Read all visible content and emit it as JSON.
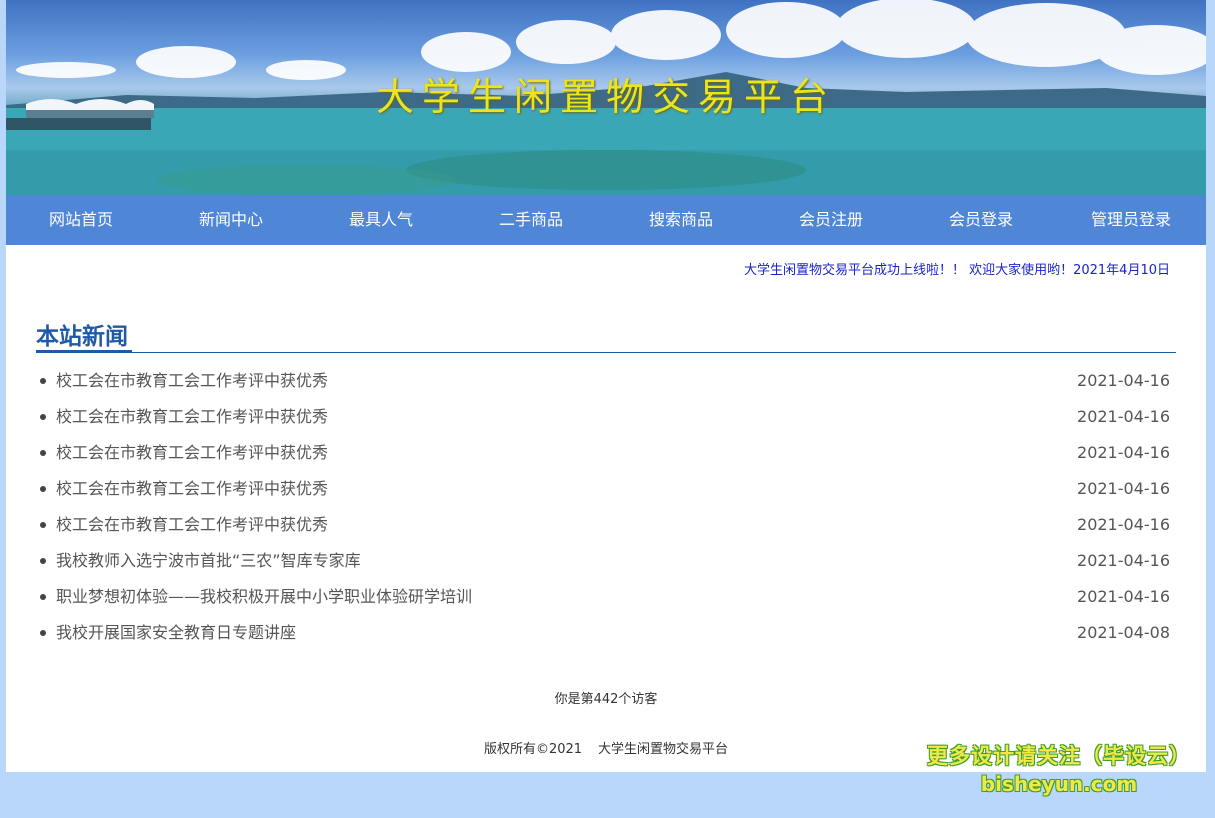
{
  "banner": {
    "title": "大学生闲置物交易平台"
  },
  "nav": {
    "items": [
      "网站首页",
      "新闻中心",
      "最具人气",
      "二手商品",
      "搜索商品",
      "会员注册",
      "会员登录",
      "管理员登录"
    ]
  },
  "marquee": {
    "text": "大学生闲置物交易平台成功上线啦！！ 欢迎大家使用哟！2021年4月10日"
  },
  "news": {
    "title": "本站新闻",
    "items": [
      {
        "title": "校工会在市教育工会工作考评中获优秀",
        "date": "2021-04-16"
      },
      {
        "title": "校工会在市教育工会工作考评中获优秀",
        "date": "2021-04-16"
      },
      {
        "title": "校工会在市教育工会工作考评中获优秀",
        "date": "2021-04-16"
      },
      {
        "title": "校工会在市教育工会工作考评中获优秀",
        "date": "2021-04-16"
      },
      {
        "title": "校工会在市教育工会工作考评中获优秀",
        "date": "2021-04-16"
      },
      {
        "title": "我校教师入选宁波市首批“三农”智库专家库",
        "date": "2021-04-16"
      },
      {
        "title": "职业梦想初体验——我校积极开展中小学职业体验研学培训",
        "date": "2021-04-16"
      },
      {
        "title": "我校开展国家安全教育日专题讲座",
        "date": "2021-04-08"
      }
    ]
  },
  "footer": {
    "visitors": "你是第442个访客",
    "copyright": "版权所有©2021",
    "site_name": "大学生闲置物交易平台"
  },
  "watermark": {
    "line1": "更多设计请关注（毕设云）",
    "line2": "bisheyun.com"
  }
}
